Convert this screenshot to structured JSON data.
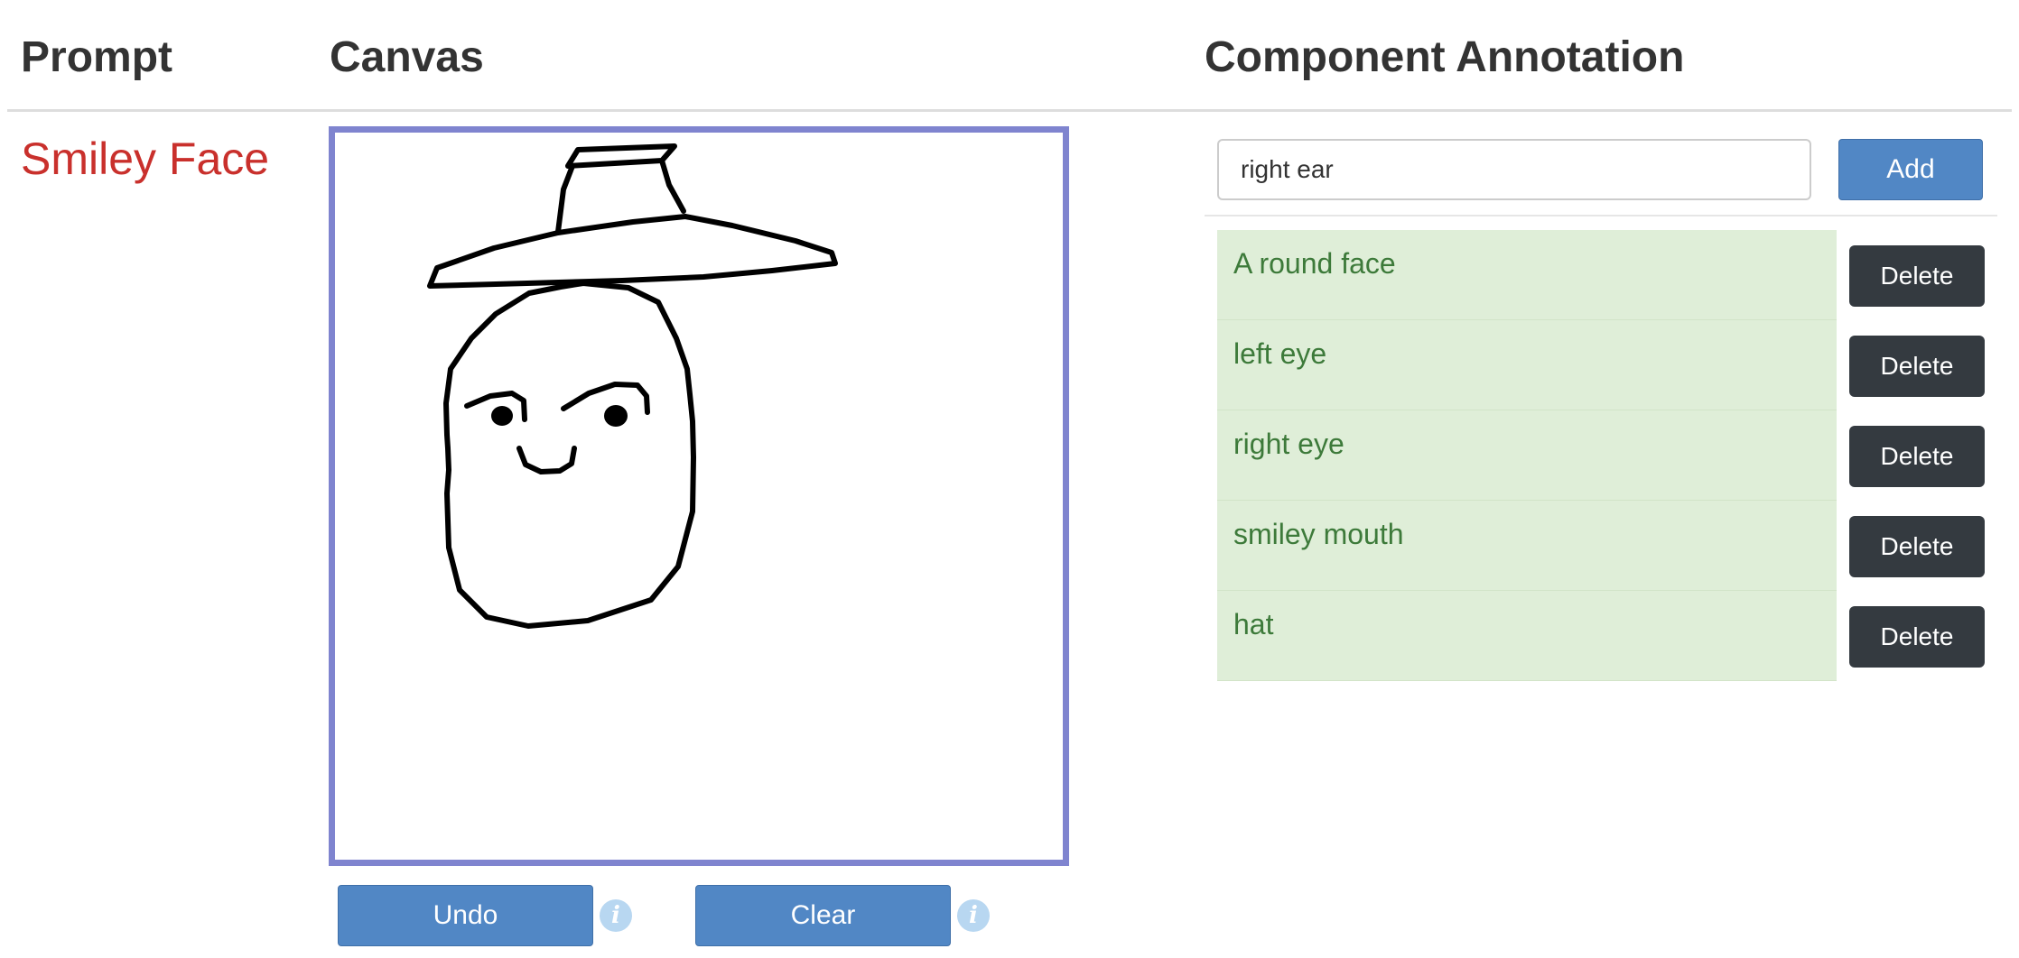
{
  "headers": {
    "prompt": "Prompt",
    "canvas": "Canvas",
    "annotation": "Component Annotation"
  },
  "prompt": {
    "text": "Smiley Face",
    "color": "#c9302c"
  },
  "canvas": {
    "border_color": "#7f84cf",
    "drawing": [
      "hat",
      "face outline",
      "left eyebrow",
      "left eye",
      "right eyebrow",
      "right eye",
      "smile"
    ]
  },
  "buttons": {
    "undo": "Undo",
    "clear": "Clear",
    "add": "Add",
    "delete": "Delete",
    "info_glyph": "i",
    "accent_color": "#5187c5"
  },
  "annotation_input": {
    "value": "right ear"
  },
  "annotations": [
    "A round face",
    "left eye",
    "right eye",
    "smiley mouth",
    "hat"
  ]
}
